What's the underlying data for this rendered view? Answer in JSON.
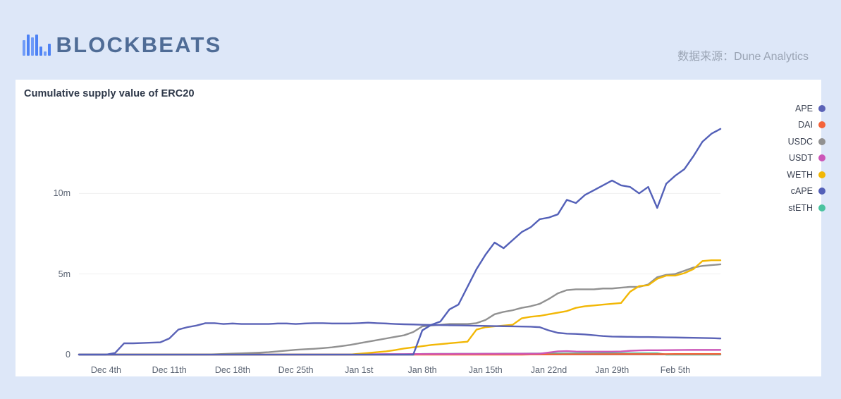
{
  "brand": {
    "name": "BLOCKBEATS",
    "icon": "bar-logo-icon"
  },
  "source": {
    "text": "数据来源：Dune Analytics"
  },
  "card": {
    "title": "Cumulative supply value of ERC20"
  },
  "legend": {
    "items": [
      {
        "label": "APE",
        "color": "#5b63b7"
      },
      {
        "label": "DAI",
        "color": "#f4633a"
      },
      {
        "label": "USDC",
        "color": "#919191"
      },
      {
        "label": "USDT",
        "color": "#cc57b8"
      },
      {
        "label": "WETH",
        "color": "#f2b705"
      },
      {
        "label": "cAPE",
        "color": "#5360b8"
      },
      {
        "label": "stETH",
        "color": "#4ac3a0"
      }
    ]
  },
  "chart_data": {
    "type": "line",
    "title": "Cumulative supply value of ERC20",
    "xlabel": "",
    "ylabel": "",
    "ylim": [
      0,
      15000000
    ],
    "yticks": [
      0,
      5000000,
      10000000
    ],
    "ytick_labels": [
      "0",
      "5m",
      "10m"
    ],
    "grid": true,
    "legend_position": "right",
    "xtick_labels": [
      "Dec 4th",
      "Dec 11th",
      "Dec 18th",
      "Dec 25th",
      "Jan 1st",
      "Jan 8th",
      "Jan 15th",
      "Jan 22nd",
      "Jan 29th",
      "Feb 5th"
    ],
    "xtick_index": [
      3,
      10,
      17,
      24,
      31,
      38,
      45,
      52,
      59,
      66
    ],
    "x_count": 72,
    "series": [
      {
        "name": "APE",
        "color": "#5b63b7",
        "values": [
          0,
          0,
          0,
          0,
          100000,
          700000,
          700000,
          720000,
          740000,
          760000,
          1000000,
          1550000,
          1700000,
          1800000,
          1950000,
          1950000,
          1900000,
          1930000,
          1900000,
          1900000,
          1900000,
          1900000,
          1930000,
          1930000,
          1900000,
          1930000,
          1950000,
          1950000,
          1930000,
          1930000,
          1930000,
          1950000,
          1980000,
          1950000,
          1930000,
          1900000,
          1880000,
          1870000,
          1850000,
          1840000,
          1830000,
          1820000,
          1810000,
          1800000,
          1790000,
          1780000,
          1770000,
          1760000,
          1750000,
          1740000,
          1730000,
          1700000,
          1500000,
          1350000,
          1300000,
          1280000,
          1250000,
          1200000,
          1150000,
          1120000,
          1110000,
          1100000,
          1090000,
          1090000,
          1080000,
          1070000,
          1060000,
          1050000,
          1040000,
          1030000,
          1020000,
          1000000
        ]
      },
      {
        "name": "DAI",
        "color": "#f4633a",
        "values": [
          0,
          0,
          0,
          0,
          0,
          0,
          0,
          0,
          0,
          0,
          0,
          0,
          0,
          0,
          0,
          0,
          0,
          0,
          0,
          0,
          0,
          0,
          0,
          0,
          0,
          0,
          0,
          0,
          0,
          0,
          0,
          0,
          0,
          0,
          0,
          0,
          0,
          0,
          0,
          0,
          0,
          0,
          0,
          0,
          0,
          0,
          0,
          0,
          0,
          0,
          10000,
          10000,
          15000,
          15000,
          20000,
          20000,
          20000,
          25000,
          25000,
          25000,
          30000,
          30000,
          30000,
          30000,
          30000,
          30000,
          35000,
          35000,
          35000,
          35000,
          35000,
          35000
        ]
      },
      {
        "name": "USDC",
        "color": "#919191",
        "values": [
          0,
          0,
          0,
          0,
          0,
          0,
          0,
          0,
          0,
          0,
          0,
          0,
          0,
          0,
          0,
          20000,
          40000,
          60000,
          80000,
          100000,
          120000,
          150000,
          200000,
          250000,
          300000,
          330000,
          360000,
          400000,
          450000,
          520000,
          600000,
          700000,
          800000,
          900000,
          1000000,
          1100000,
          1200000,
          1400000,
          1750000,
          1800000,
          1850000,
          1900000,
          1900000,
          1900000,
          1950000,
          2150000,
          2500000,
          2650000,
          2750000,
          2900000,
          3000000,
          3150000,
          3450000,
          3800000,
          4000000,
          4050000,
          4050000,
          4050000,
          4100000,
          4100000,
          4150000,
          4200000,
          4200000,
          4350000,
          4800000,
          4950000,
          5000000,
          5200000,
          5400000,
          5500000,
          5550000,
          5600000
        ]
      },
      {
        "name": "USDT",
        "color": "#cc57b8",
        "values": [
          0,
          0,
          0,
          0,
          0,
          0,
          0,
          0,
          0,
          0,
          0,
          0,
          0,
          0,
          0,
          0,
          0,
          0,
          0,
          0,
          0,
          0,
          0,
          0,
          0,
          0,
          0,
          0,
          0,
          0,
          0,
          20000,
          25000,
          25000,
          30000,
          30000,
          30000,
          35000,
          35000,
          40000,
          40000,
          40000,
          45000,
          45000,
          45000,
          50000,
          50000,
          50000,
          55000,
          55000,
          55000,
          60000,
          130000,
          200000,
          215000,
          190000,
          180000,
          180000,
          180000,
          185000,
          195000,
          235000,
          260000,
          270000,
          270000,
          275000,
          280000,
          285000,
          290000,
          290000,
          290000,
          290000
        ]
      },
      {
        "name": "WETH",
        "color": "#f2b705",
        "values": [
          0,
          0,
          0,
          0,
          0,
          0,
          0,
          0,
          0,
          0,
          0,
          0,
          0,
          0,
          0,
          0,
          0,
          0,
          0,
          0,
          0,
          0,
          0,
          0,
          0,
          0,
          0,
          0,
          0,
          0,
          0,
          50000,
          100000,
          150000,
          200000,
          280000,
          380000,
          450000,
          520000,
          600000,
          650000,
          700000,
          750000,
          800000,
          1550000,
          1700000,
          1750000,
          1800000,
          1850000,
          2250000,
          2350000,
          2400000,
          2500000,
          2600000,
          2700000,
          2900000,
          3000000,
          3050000,
          3100000,
          3150000,
          3200000,
          3900000,
          4250000,
          4300000,
          4700000,
          4900000,
          4900000,
          5050000,
          5300000,
          5800000,
          5850000,
          5850000
        ]
      },
      {
        "name": "cAPE",
        "color": "#5360b8",
        "values": [
          0,
          0,
          0,
          0,
          0,
          0,
          0,
          0,
          0,
          0,
          0,
          0,
          0,
          0,
          0,
          0,
          0,
          0,
          0,
          0,
          0,
          0,
          0,
          0,
          0,
          0,
          0,
          0,
          0,
          0,
          0,
          0,
          0,
          0,
          0,
          0,
          0,
          0,
          1500000,
          1850000,
          2050000,
          2800000,
          3100000,
          4200000,
          5300000,
          6200000,
          6950000,
          6600000,
          7100000,
          7600000,
          7900000,
          8400000,
          8500000,
          8700000,
          9600000,
          9400000,
          9900000,
          10200000,
          10500000,
          10800000,
          10500000,
          10400000,
          10000000,
          10400000,
          9100000,
          10600000,
          11100000,
          11500000,
          12300000,
          13200000,
          13700000,
          14000000
        ]
      },
      {
        "name": "stETH",
        "color": "#4ac3a0",
        "values": [
          0,
          0,
          0,
          0,
          0,
          0,
          0,
          0,
          0,
          0,
          0,
          0,
          0,
          0,
          0,
          0,
          0,
          0,
          0,
          0,
          0,
          0,
          0,
          0,
          0,
          0,
          0,
          0,
          0,
          0,
          0,
          0,
          0,
          0,
          0,
          0,
          0,
          0,
          40000,
          40000,
          45000,
          45000,
          50000,
          50000,
          50000,
          55000,
          55000,
          60000,
          60000,
          60000,
          65000,
          65000,
          70000,
          70000,
          70000,
          75000,
          75000,
          75000,
          80000,
          80000,
          80000,
          80000,
          80000,
          80000,
          80000,
          0,
          0,
          0,
          0,
          0,
          0,
          0
        ]
      }
    ]
  }
}
